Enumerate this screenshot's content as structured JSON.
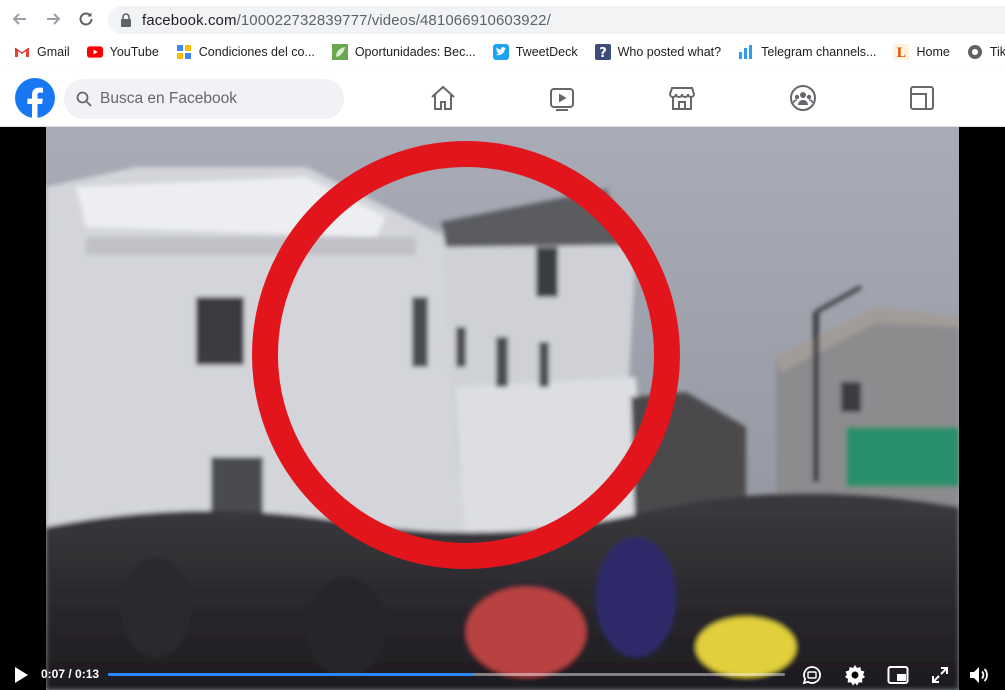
{
  "browser": {
    "url_host": "facebook.com",
    "url_path": "/100022732839777/videos/481066910603922/",
    "bookmarks": [
      {
        "label": "Gmail",
        "icon": "gmail-icon"
      },
      {
        "label": "YouTube",
        "icon": "youtube-icon"
      },
      {
        "label": "Condiciones del co...",
        "icon": "pinwheel-icon"
      },
      {
        "label": "Oportunidades: Bec...",
        "icon": "leaf-icon"
      },
      {
        "label": "TweetDeck",
        "icon": "tweetdeck-icon"
      },
      {
        "label": "Who posted what?",
        "icon": "question-icon"
      },
      {
        "label": "Telegram channels...",
        "icon": "chart-bars-icon"
      },
      {
        "label": "Home",
        "icon": "letter-l-icon"
      },
      {
        "label": "TikTok We",
        "icon": "globe-icon"
      }
    ]
  },
  "facebook": {
    "search_placeholder": "Busca en Facebook",
    "nav": [
      "home-icon",
      "watch-icon",
      "marketplace-icon",
      "groups-icon",
      "gaming-icon"
    ],
    "brand_color": "#1877f2"
  },
  "video": {
    "current_time": "0:07",
    "duration": "0:13",
    "time_display": "0:07 / 0:13",
    "progress": 0.54,
    "progress_color": "#2d88ff",
    "annotation_color": "#e3151c",
    "controls": [
      "play-icon",
      "captions-icon",
      "settings-icon",
      "miniplayer-icon",
      "fullscreen-icon",
      "volume-icon"
    ]
  }
}
